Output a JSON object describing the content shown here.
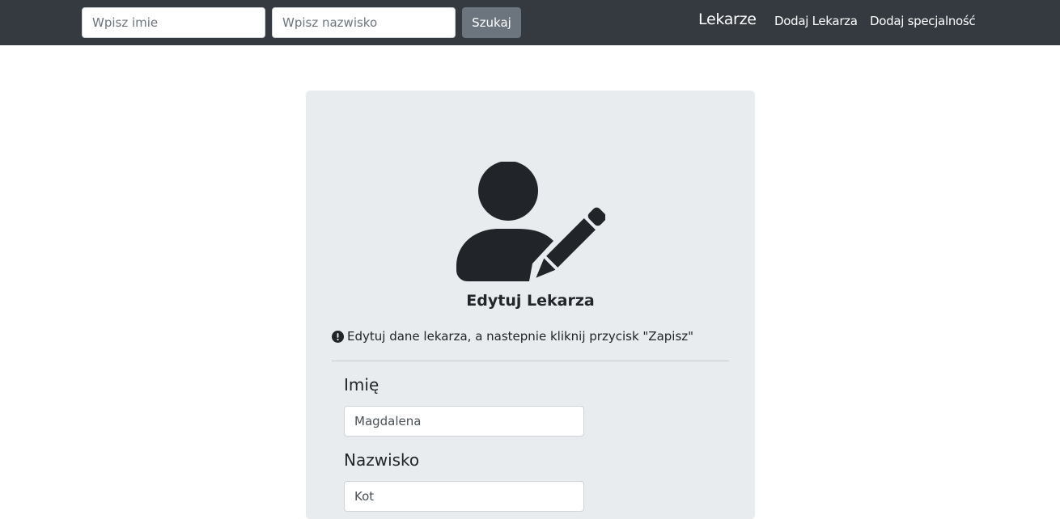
{
  "navbar": {
    "search_first_placeholder": "Wpisz imie",
    "search_last_placeholder": "Wpisz nazwisko",
    "search_button": "Szukaj",
    "brand": "Lekarze",
    "links": [
      "Dodaj Lekarza",
      "Dodaj specjalność"
    ]
  },
  "card": {
    "icon": "user-edit-icon",
    "title": "Edytuj Lekarza",
    "info_icon": "exclamation-circle-icon",
    "info_text": "Edytuj dane lekarza, a nastepnie kliknij przycisk \"Zapisz\"",
    "fields": [
      {
        "label": "Imię",
        "value": "Magdalena"
      },
      {
        "label": "Nazwisko",
        "value": "Kot"
      }
    ]
  },
  "colors": {
    "navbar_bg": "#343a40",
    "card_bg": "#e9ecef",
    "button_secondary": "#6c757d",
    "icon_dark": "#212529"
  }
}
